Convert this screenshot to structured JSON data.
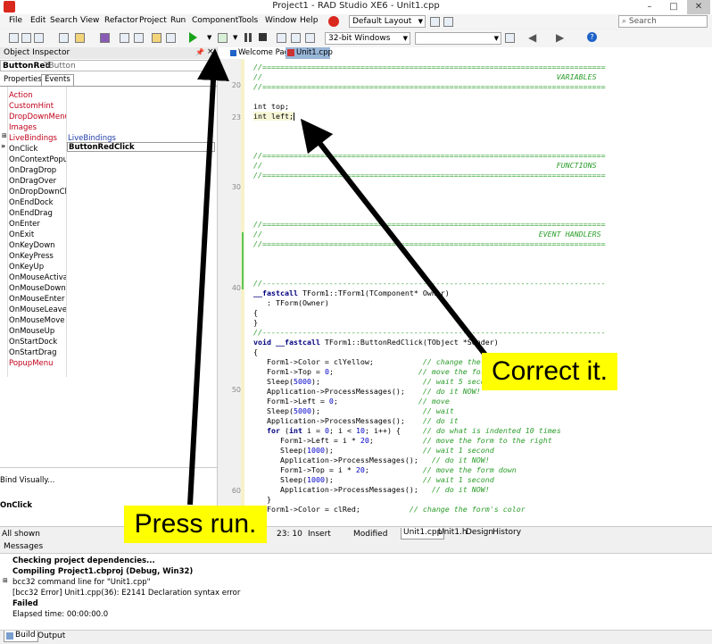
{
  "window": {
    "title": "Project1 - RAD Studio XE6 - Unit1.cpp",
    "controls": [
      "–",
      "□",
      "✕"
    ]
  },
  "menu": [
    "File",
    "Edit",
    "Search",
    "View",
    "Refactor",
    "Project",
    "Run",
    "Component",
    "Tools",
    "Window",
    "Help"
  ],
  "layout_select": "Default Layout",
  "search_placeholder": "Search",
  "platform_select": "32-bit Windows",
  "tabs": [
    "Welcome Page",
    "Unit1.cpp"
  ],
  "object_inspector": {
    "title": "Object Inspector",
    "component_name": "ButtonRed",
    "component_type": "TButton",
    "tabs": [
      "Properties",
      "Events"
    ],
    "events": [
      {
        "name": "Action",
        "value": "",
        "red": true
      },
      {
        "name": "CustomHint",
        "value": "",
        "red": true
      },
      {
        "name": "DropDownMenu",
        "value": "",
        "red": true
      },
      {
        "name": "Images",
        "value": "",
        "red": true
      },
      {
        "name": "LiveBindings",
        "value": "LiveBindings",
        "red": true
      },
      {
        "name": "OnClick",
        "value": "ButtonRedClick",
        "red": false
      },
      {
        "name": "OnContextPopup",
        "value": "",
        "red": false
      },
      {
        "name": "OnDragDrop",
        "value": "",
        "red": false
      },
      {
        "name": "OnDragOver",
        "value": "",
        "red": false
      },
      {
        "name": "OnDropDownClick",
        "value": "",
        "red": false
      },
      {
        "name": "OnEndDock",
        "value": "",
        "red": false
      },
      {
        "name": "OnEndDrag",
        "value": "",
        "red": false
      },
      {
        "name": "OnEnter",
        "value": "",
        "red": false
      },
      {
        "name": "OnExit",
        "value": "",
        "red": false
      },
      {
        "name": "OnKeyDown",
        "value": "",
        "red": false
      },
      {
        "name": "OnKeyPress",
        "value": "",
        "red": false
      },
      {
        "name": "OnKeyUp",
        "value": "",
        "red": false
      },
      {
        "name": "OnMouseActivate",
        "value": "",
        "red": false
      },
      {
        "name": "OnMouseDown",
        "value": "",
        "red": false
      },
      {
        "name": "OnMouseEnter",
        "value": "",
        "red": false
      },
      {
        "name": "OnMouseLeave",
        "value": "",
        "red": false
      },
      {
        "name": "OnMouseMove",
        "value": "",
        "red": false
      },
      {
        "name": "OnMouseUp",
        "value": "",
        "red": false
      },
      {
        "name": "OnStartDock",
        "value": "",
        "red": false
      },
      {
        "name": "OnStartDrag",
        "value": "",
        "red": false
      },
      {
        "name": "PopupMenu",
        "value": "",
        "red": true
      }
    ],
    "bind_visually": "Bind Visually...",
    "selected_event": "OnClick",
    "filter": "All shown"
  },
  "line_numbers": [
    "20",
    "23",
    "30",
    "40",
    "50",
    "60"
  ],
  "status": {
    "position": "23: 10",
    "mode": "Insert",
    "state": "Modified",
    "tabs": [
      "Unit1.cpp",
      "Unit1.h",
      "Design",
      "History"
    ]
  },
  "messages": {
    "title": "Messages",
    "lines": [
      {
        "text": "Checking project dependencies...",
        "bold": true
      },
      {
        "text": "Compiling Project1.cbproj (Debug, Win32)",
        "bold": true
      },
      {
        "text": "bcc32 command line for \"Unit1.cpp\"",
        "bold": false
      },
      {
        "text": "[bcc32 Error] Unit1.cpp(36): E2141 Declaration syntax error",
        "bold": false
      },
      {
        "text": "Failed",
        "bold": true
      },
      {
        "text": "Elapsed time: 00:00:00.0",
        "bold": false
      }
    ],
    "bottom_tabs": [
      "Build",
      "Output"
    ]
  },
  "callouts": {
    "correct": "Correct it.",
    "press_run": "Press run."
  }
}
